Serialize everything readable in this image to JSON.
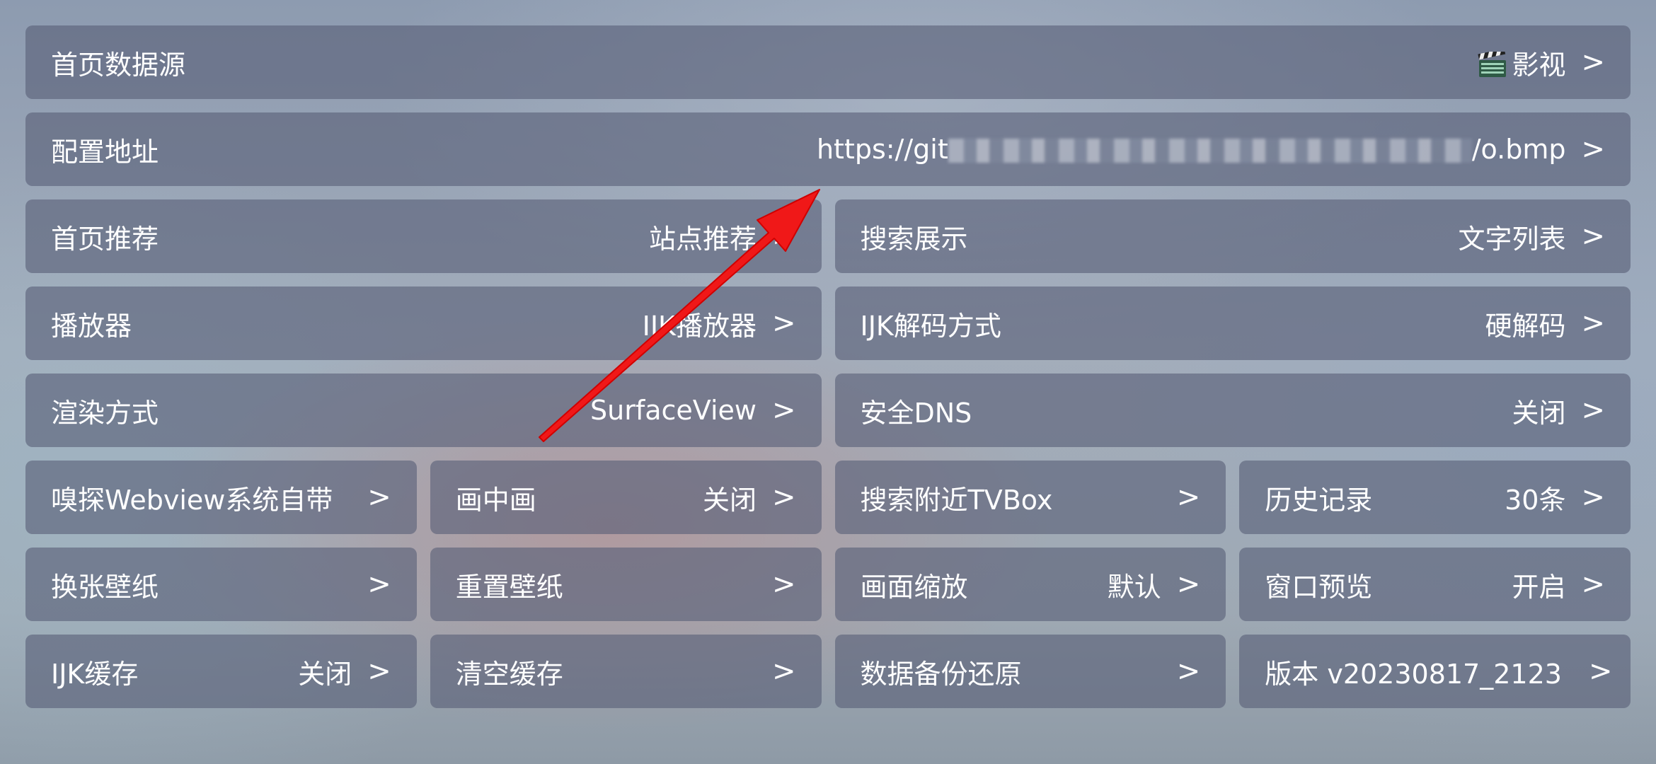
{
  "settings": {
    "home_source": {
      "label": "首页数据源",
      "value": "影视"
    },
    "config_url": {
      "label": "配置地址",
      "value_start": "https://git",
      "value_end": "/o.bmp"
    },
    "home_recommend": {
      "label": "首页推荐",
      "value": "站点推荐"
    },
    "search_display": {
      "label": "搜索展示",
      "value": "文字列表"
    },
    "player": {
      "label": "播放器",
      "value": "IJK播放器"
    },
    "ijk_decode": {
      "label": "IJK解码方式",
      "value": "硬解码"
    },
    "render_mode": {
      "label": "渲染方式",
      "value": "SurfaceView"
    },
    "secure_dns": {
      "label": "安全DNS",
      "value": "关闭"
    },
    "sniff_webview": {
      "label": "嗅探Webview系统自带",
      "value": ""
    },
    "pip": {
      "label": "画中画",
      "value": "关闭"
    },
    "search_nearby": {
      "label": "搜索附近TVBox",
      "value": ""
    },
    "history": {
      "label": "历史记录",
      "value": "30条"
    },
    "change_wallpaper": {
      "label": "换张壁纸",
      "value": ""
    },
    "reset_wallpaper": {
      "label": "重置壁纸",
      "value": ""
    },
    "screen_scale": {
      "label": "画面缩放",
      "value": "默认"
    },
    "window_preview": {
      "label": "窗口预览",
      "value": "开启"
    },
    "ijk_cache": {
      "label": "IJK缓存",
      "value": "关闭"
    },
    "clear_cache": {
      "label": "清空缓存",
      "value": ""
    },
    "backup_restore": {
      "label": "数据备份还原",
      "value": ""
    },
    "version": {
      "label": "版本 v20230817_2123",
      "value": ""
    }
  },
  "chevron": ">",
  "icons": {
    "home_source_icon": "clapperboard-icon"
  },
  "colors": {
    "tile_bg": "#5a6078",
    "annotation_arrow": "#f01818"
  }
}
